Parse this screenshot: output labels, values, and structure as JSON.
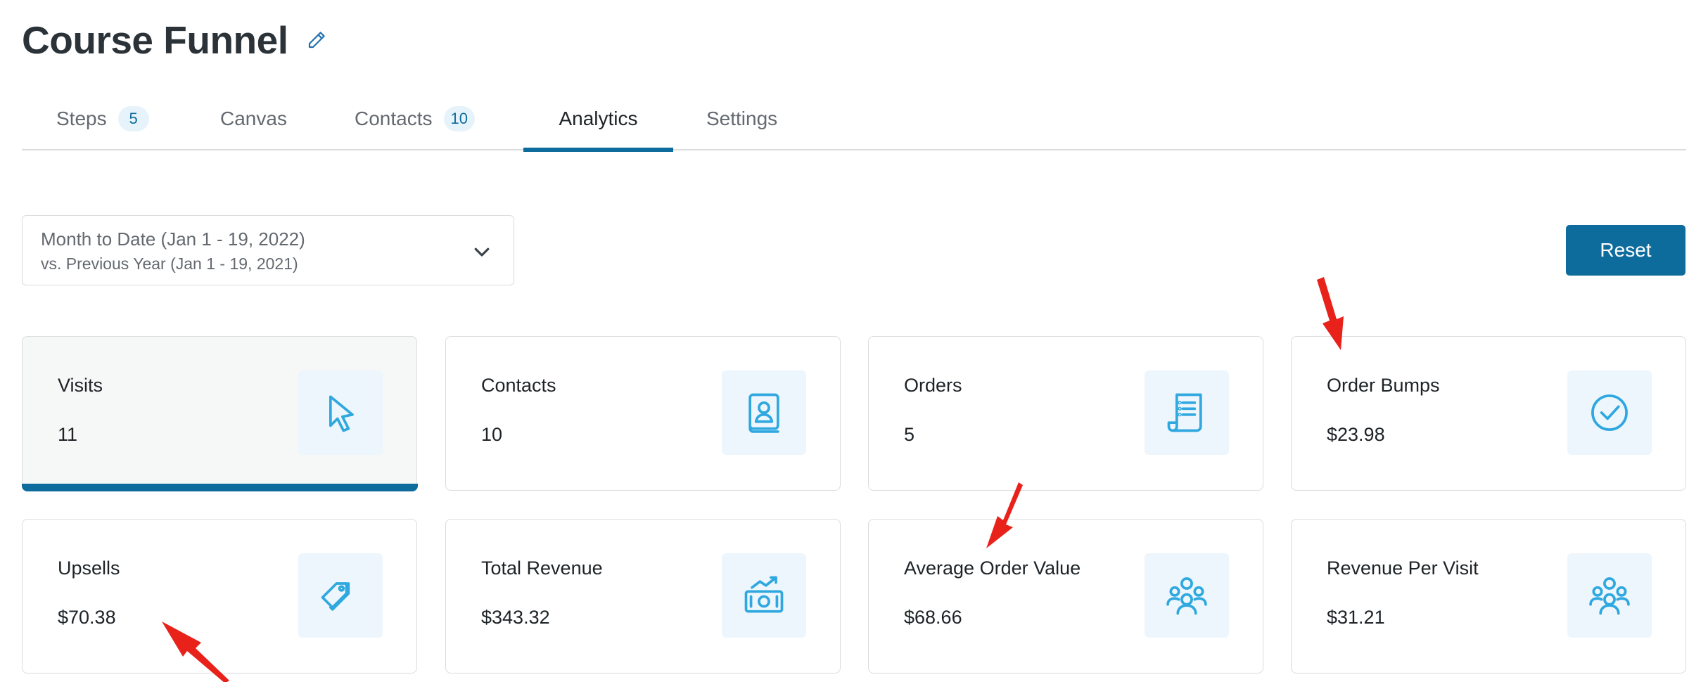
{
  "header": {
    "title": "Course Funnel"
  },
  "tabs": [
    {
      "label": "Steps",
      "badge": "5"
    },
    {
      "label": "Canvas",
      "badge": ""
    },
    {
      "label": "Contacts",
      "badge": "10"
    },
    {
      "label": "Analytics",
      "badge": "",
      "active": true
    },
    {
      "label": "Settings",
      "badge": ""
    }
  ],
  "date_filter": {
    "range": "Month to Date (Jan 1 - 19, 2022)",
    "compare": "vs. Previous Year (Jan 1 - 19, 2021)"
  },
  "reset_label": "Reset",
  "cards": [
    {
      "label": "Visits",
      "value": "11",
      "icon": "cursor-icon",
      "active": true
    },
    {
      "label": "Contacts",
      "value": "10",
      "icon": "contact-book-icon"
    },
    {
      "label": "Orders",
      "value": "5",
      "icon": "receipt-icon"
    },
    {
      "label": "Order Bumps",
      "value": "$23.98",
      "icon": "check-circle-icon"
    },
    {
      "label": "Upsells",
      "value": "$70.38",
      "icon": "tags-icon"
    },
    {
      "label": "Total Revenue",
      "value": "$343.32",
      "icon": "money-growth-icon"
    },
    {
      "label": "Average Order Value",
      "value": "$68.66",
      "icon": "users-group-icon"
    },
    {
      "label": "Revenue Per Visit",
      "value": "$31.21",
      "icon": "users-group-icon"
    }
  ],
  "colors": {
    "accent": "#0e6c9d",
    "icon": "#2ea8df",
    "icon_bg": "#eef6fd",
    "annotation_arrow": "#e8211b"
  }
}
